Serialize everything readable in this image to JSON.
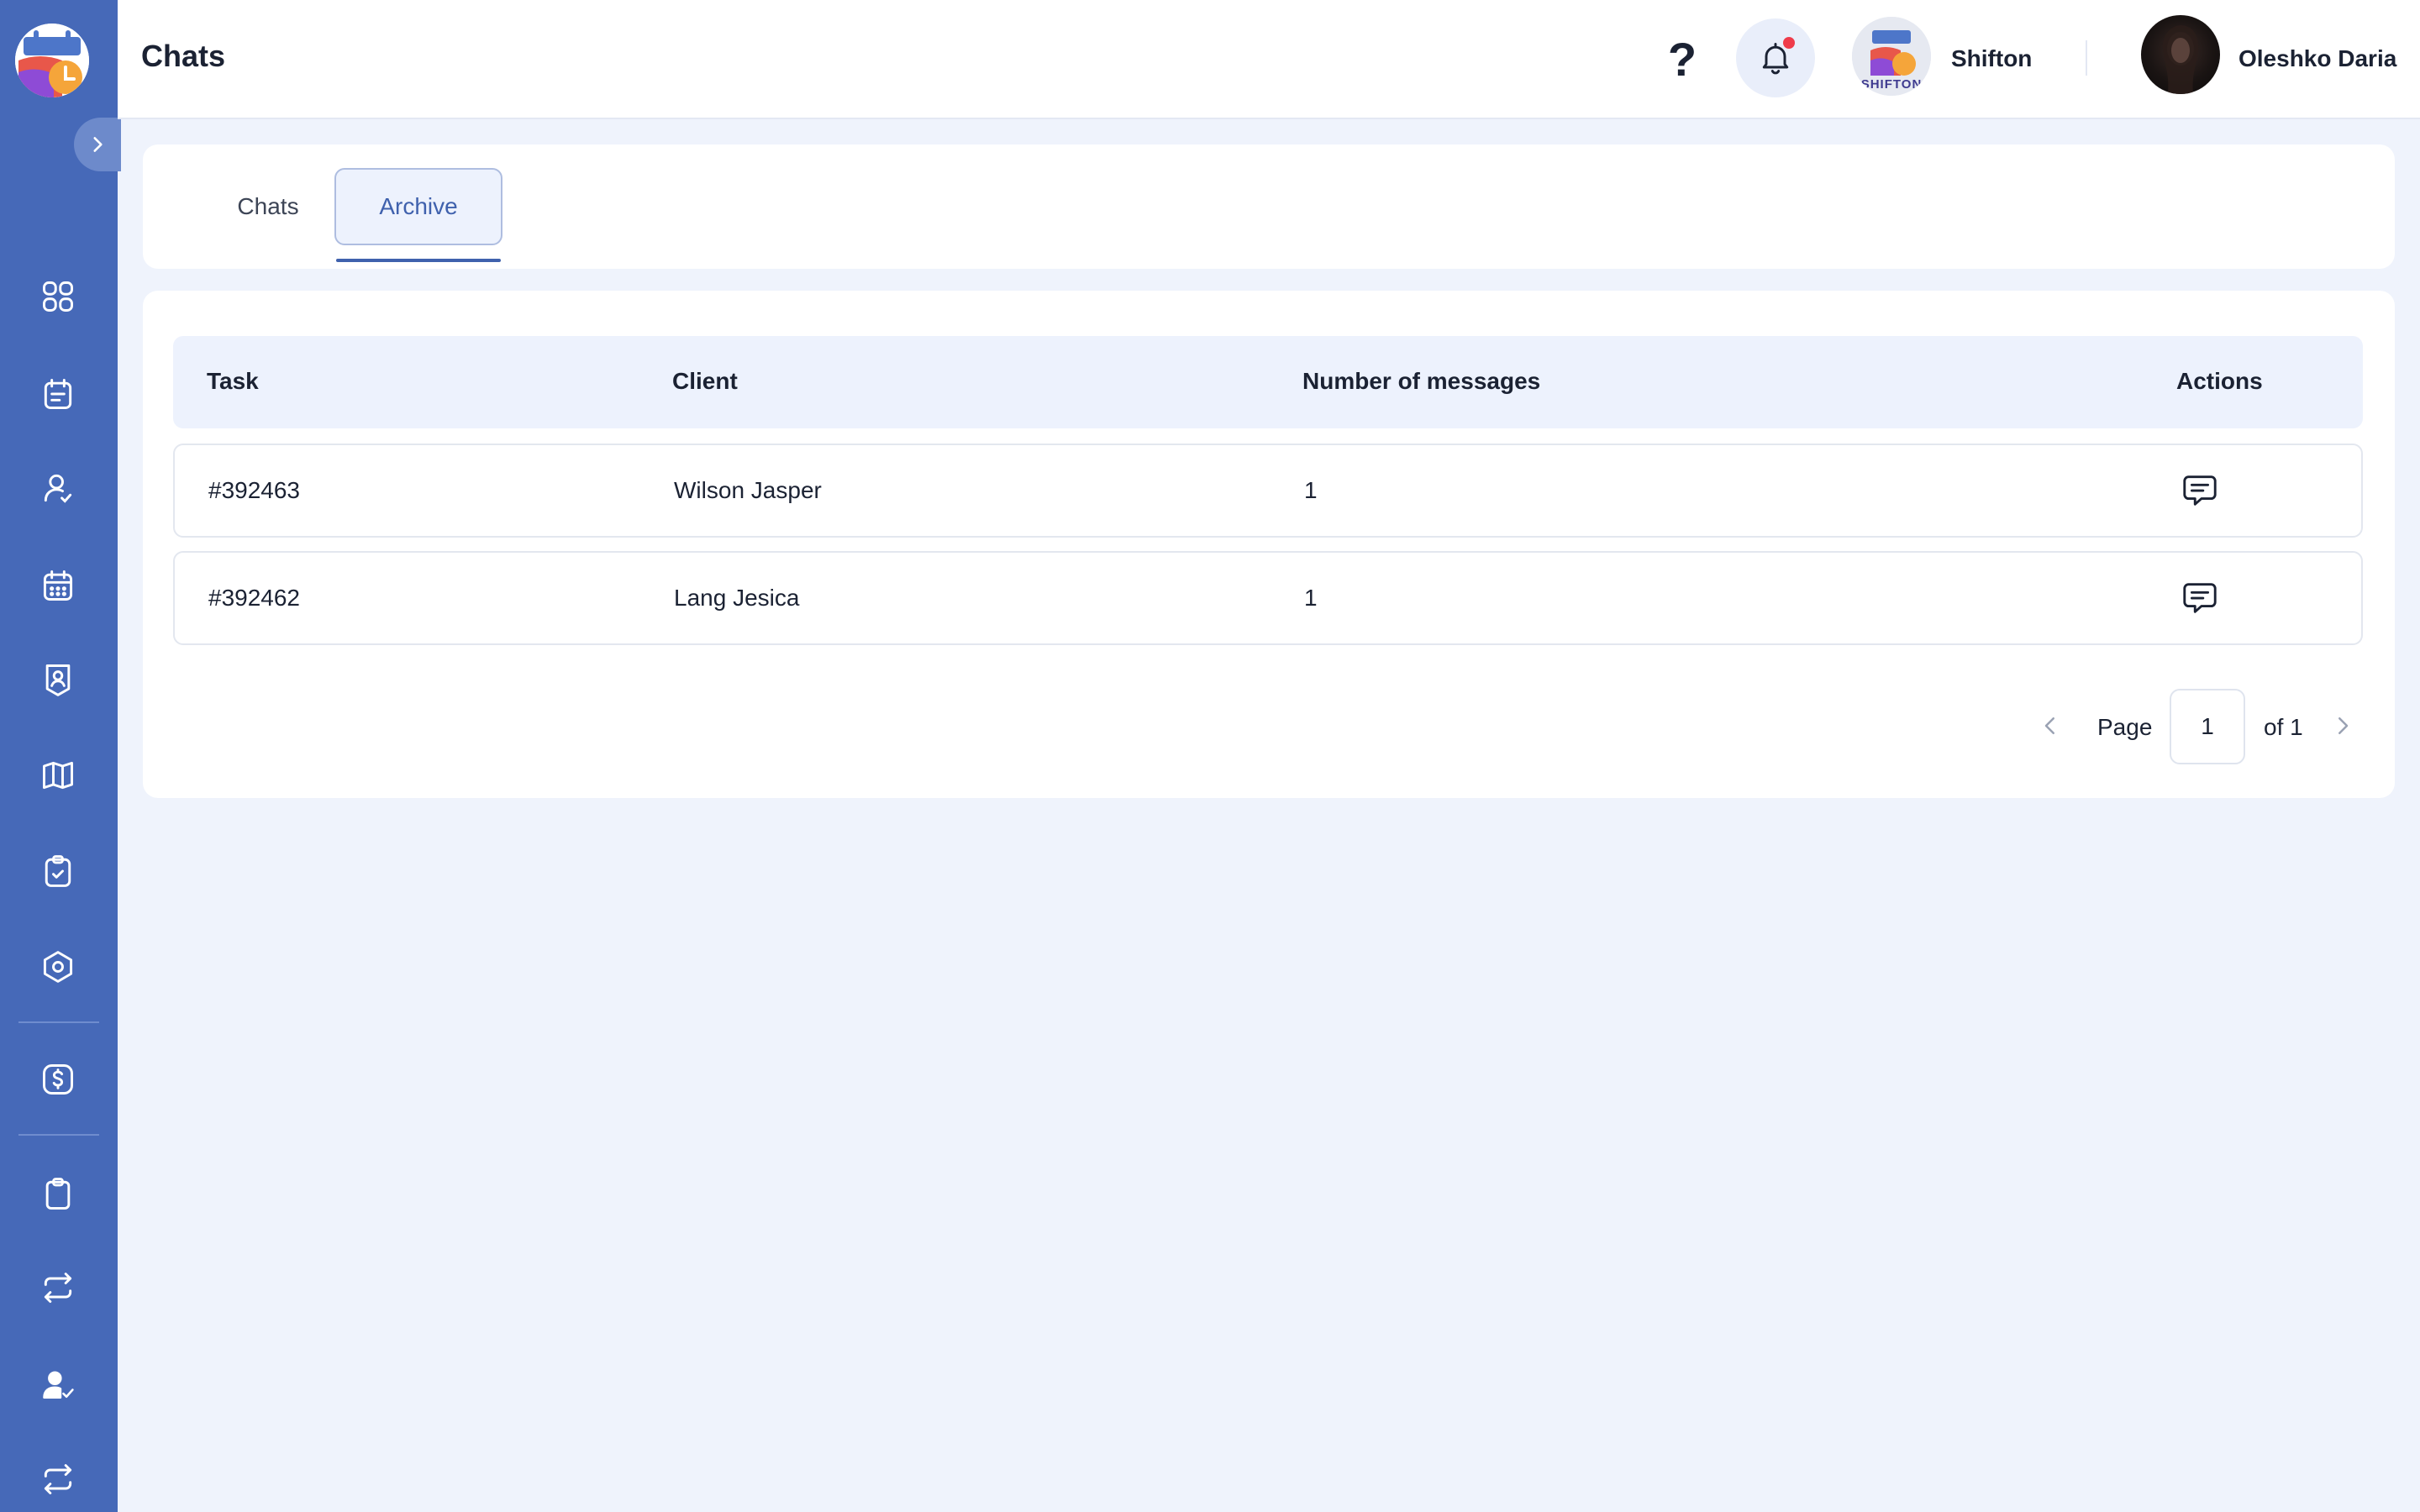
{
  "header": {
    "title": "Chats",
    "help_icon": "?",
    "company_name": "Shifton",
    "user_name": "Oleshko Daria"
  },
  "sidebar": {
    "items": [
      {
        "icon": "dashboard-grid-icon"
      },
      {
        "icon": "notes-calendar-icon"
      },
      {
        "icon": "user-check-icon"
      },
      {
        "icon": "calendar-icon"
      },
      {
        "icon": "profile-badge-icon"
      },
      {
        "icon": "map-icon"
      },
      {
        "icon": "task-check-icon"
      },
      {
        "icon": "settings-hexagon-icon"
      },
      {
        "icon": "dollar-icon"
      },
      {
        "icon": "clipboard-icon"
      },
      {
        "icon": "exchange-icon"
      },
      {
        "icon": "user-approve-icon"
      },
      {
        "icon": "exchange-icon"
      }
    ]
  },
  "tabs": [
    {
      "label": "Chats",
      "active": false
    },
    {
      "label": "Archive",
      "active": true
    }
  ],
  "table": {
    "columns": [
      "Task",
      "Client",
      "Number of messages",
      "Actions"
    ],
    "rows": [
      {
        "task": "#392463",
        "client": "Wilson Jasper",
        "messages": "1",
        "action_icon": "chat-icon"
      },
      {
        "task": "#392462",
        "client": "Lang Jesica",
        "messages": "1",
        "action_icon": "chat-icon"
      }
    ]
  },
  "pagination": {
    "page_label": "Page",
    "current_page": "1",
    "of_label": "of 1"
  },
  "colors": {
    "sidebar": "#4669b8",
    "accent": "#3f61ad",
    "background": "#eff3fc",
    "notification_dot": "#ef3b4a"
  }
}
